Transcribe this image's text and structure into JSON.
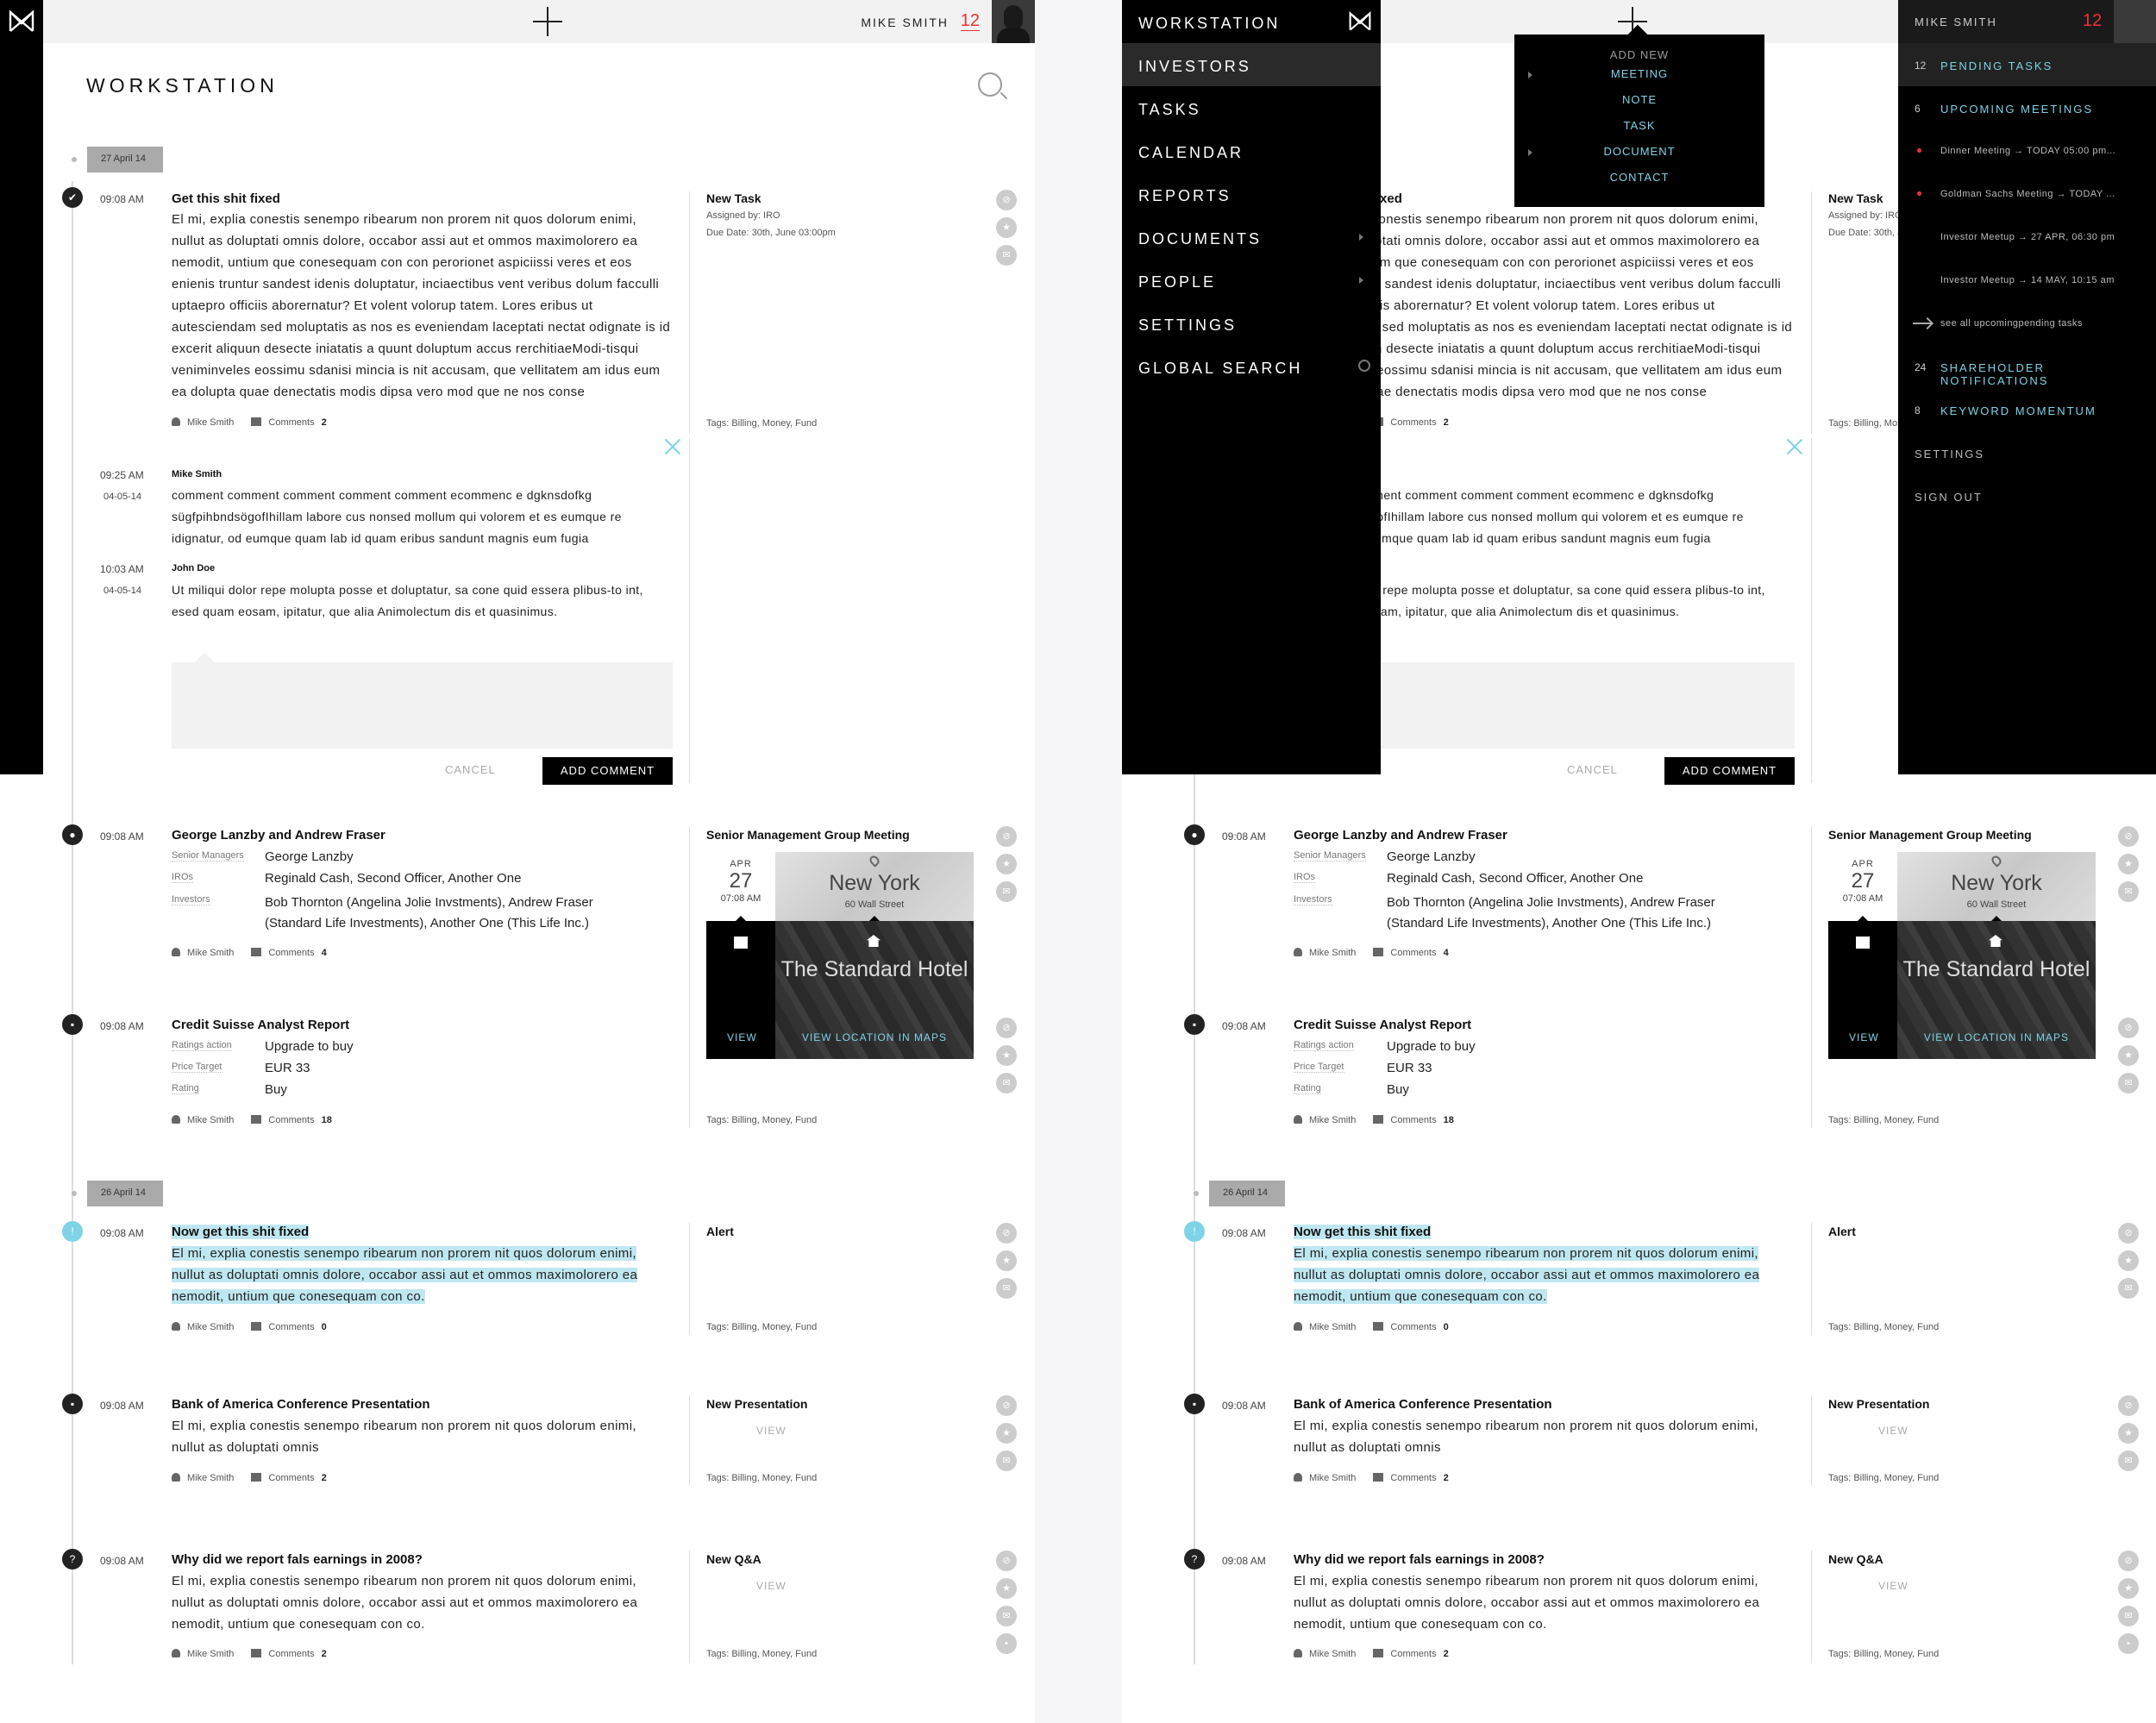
{
  "header": {
    "user_name": "MIKE SMITH",
    "notification_count": "12"
  },
  "page_title": "WORKSTATION",
  "dates": {
    "first": "27 April 14",
    "second": "26 April 14"
  },
  "feed": {
    "task": {
      "time": "09:08 AM",
      "title": "Get this shit fixed",
      "body": "El mi, explia conestis senempo ribearum non prorem nit quos dolorum enimi, nullut as doluptati omnis dolore, occabor assi aut et ommos maximolorero ea nemodit, untium que conesequam con con perorionet aspiciissi veres et eos enienis truntur sandest idenis doluptatur, inciaectibus vent veribus dolum facculli uptaepro officiis aborernatur? Et volent volorup tatem. Lores eribus ut autesciendam sed moluptatis as nos es eveniendam laceptati nectat odignate is id excerit aliquun desecte iniatatis a quunt doluptum accus rerchitiaeModi-tisqui veniminveles eossimu sdanisi mincia is nit accusam, que vellitatem am idus eum ea dolupta quae denectatis modis dipsa vero mod que ne nos conse",
      "author": "Mike Smith",
      "comments_label": "Comments",
      "comments_count": "2",
      "right_title": "New Task",
      "assigned": "Assigned by: IRO",
      "due": "Due Date: 30th, June 03:00pm",
      "tags": "Tags: Billing, Money, Fund"
    },
    "comments": [
      {
        "time": "09:25 AM",
        "date": "04-05-14",
        "name": "Mike Smith",
        "text": "comment comment comment comment comment ecommenc e dgknsdofkg sügfpihbndsögofIhillam labore cus nonsed mollum qui volorem et es eumque re idignatur, od eumque quam lab id quam eribus sandunt magnis eum fugia"
      },
      {
        "time": "10:03 AM",
        "date": "04-05-14",
        "name": "John Doe",
        "text": "Ut miliqui dolor repe molupta posse et doluptatur, sa cone quid essera plibus-to int, esed quam eosam, ipitatur, que alia Animolectum dis et quasinimus."
      }
    ],
    "cancel_label": "CANCEL",
    "add_comment_label": "ADD COMMENT",
    "meeting": {
      "time": "09:08 AM",
      "title": "George Lanzby and Andrew Fraser",
      "fields": [
        {
          "label": "Senior Managers",
          "value": "George Lanzby"
        },
        {
          "label": "IROs",
          "value": "Reginald Cash, Second Officer, Another One"
        },
        {
          "label": "Investors",
          "value": "Bob Thornton (Angelina Jolie Invstments), Andrew Fraser (Standard Life Investments), Another One (This Life Inc.)"
        }
      ],
      "author": "Mike Smith",
      "comments_label": "Comments",
      "comments_count": "4",
      "right_title": "Senior Management Group Meeting",
      "card": {
        "month": "APR",
        "day": "27",
        "time": "07:08 AM",
        "city": "New York",
        "street": "60 Wall Street",
        "venue": "The Standard Hotel",
        "view": "VIEW",
        "view_location": "VIEW LOCATION IN MAPS"
      }
    },
    "report": {
      "time": "09:08 AM",
      "title": "Credit Suisse Analyst Report",
      "fields": [
        {
          "label": "Ratings action",
          "value": "Upgrade to buy"
        },
        {
          "label": "Price Target",
          "value": "EUR 33"
        },
        {
          "label": "Rating",
          "value": "Buy"
        }
      ],
      "author": "Mike Smith",
      "comments_label": "Comments",
      "comments_count": "18",
      "tags": "Tags: Billing, Money, Fund"
    },
    "alert": {
      "time": "09:08 AM",
      "title": "Now get this shit fixed",
      "body": "El mi, explia conestis senempo ribearum non prorem nit quos dolorum enimi, nullut as doluptati omnis dolore, occabor assi aut et ommos maximolorero ea nemodit, untium que conesequam con co.",
      "author": "Mike Smith",
      "comments_label": "Comments",
      "comments_count": "0",
      "right_title": "Alert",
      "tags": "Tags: Billing, Money, Fund"
    },
    "presentation": {
      "time": "09:08 AM",
      "title": "Bank of America Conference Presentation",
      "body": "El mi, explia conestis senempo ribearum non prorem nit quos dolorum enimi, nullut as doluptati omnis",
      "author": "Mike Smith",
      "comments_label": "Comments",
      "comments_count": "2",
      "right_title": "New Presentation",
      "view": "VIEW",
      "tags": "Tags: Billing, Money, Fund"
    },
    "qa": {
      "time": "09:08 AM",
      "title": "Why did we report fals earnings in 2008?",
      "body": "El mi, explia conestis senempo ribearum non prorem nit quos dolorum enimi, nullut as doluptati omnis dolore, occabor assi aut et ommos maximolorero ea nemodit, untium que conesequam con co.",
      "author": "Mike Smith",
      "comments_label": "Comments",
      "comments_count": "2",
      "right_title": "New Q&A",
      "view": "VIEW",
      "tags": "Tags: Billing, Money, Fund"
    }
  },
  "nav_menu": {
    "title": "WORKSTATION",
    "items": [
      "INVESTORS",
      "TASKS",
      "CALENDAR",
      "REPORTS",
      "DOCUMENTS",
      "PEOPLE",
      "SETTINGS",
      "GLOBAL SEARCH"
    ]
  },
  "add_new_menu": {
    "title": "ADD NEW",
    "items": [
      "MEETING",
      "NOTE",
      "TASK",
      "DOCUMENT",
      "CONTACT"
    ]
  },
  "user_panel": {
    "user_name": "MIKE SMITH",
    "count": "12",
    "pending_count": "12",
    "pending_label": "PENDING TASKS",
    "upcoming_count": "6",
    "upcoming_label": "UPCOMING MEETINGS",
    "events": [
      "Dinner Meeting → TODAY 05:00 pm...",
      "Goldman Sachs Meeting → TODAY ...",
      "Investor Meetup → 27 APR, 06:30 pm",
      "Investor Meetup → 14 MAY, 10:15 am"
    ],
    "see_all": "see all upcomingpending tasks",
    "shareholder_count": "24",
    "shareholder_label": "SHAREHOLDER NOTIFICATIONS",
    "keyword_count": "8",
    "keyword_label": "KEYWORD MOMENTUM",
    "settings": "SETTINGS",
    "sign_out": "SIGN OUT"
  },
  "colors": {
    "accent": "#7fd3e6",
    "alert": "#e33333",
    "highlight": "#bfe7f1"
  }
}
